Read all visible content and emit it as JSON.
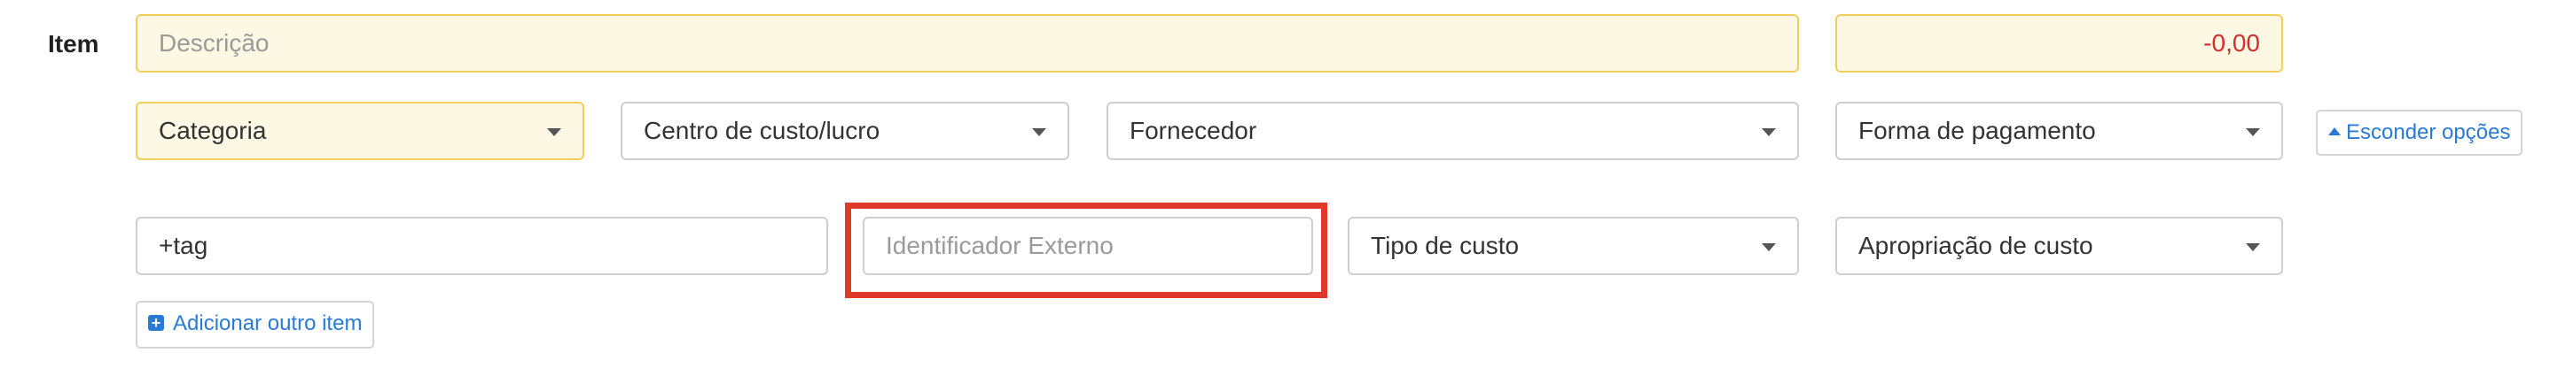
{
  "item": {
    "label": "Item",
    "description_placeholder": "Descrição",
    "amount": "-0,00"
  },
  "selects": {
    "category": "Categoria",
    "cost_center": "Centro de custo/lucro",
    "supplier": "Fornecedor",
    "payment_method": "Forma de pagamento",
    "cost_type": "Tipo de custo",
    "cost_appropriation": "Apropriação de custo"
  },
  "tags": {
    "value": "+tag"
  },
  "external_id": {
    "placeholder": "Identificador Externo"
  },
  "buttons": {
    "hide_options": "Esconder opções",
    "add_item": "Adicionar outro item"
  },
  "colors": {
    "required_bg": "#fdf8e3",
    "required_border": "#f1cf5a",
    "amount": "#d32f2f",
    "link": "#2a7ad6",
    "highlight": "#e0392b"
  },
  "icons": {
    "select_caret": "caret-down-icon",
    "hide_options": "caret-up-icon",
    "add_item": "plus-square-icon"
  }
}
